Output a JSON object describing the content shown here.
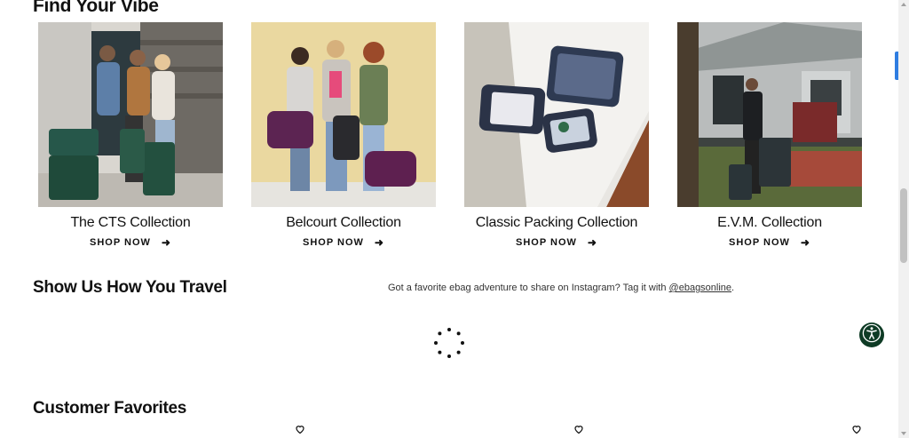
{
  "sections": {
    "vibe_title": "Find Your Vibe",
    "travel_title": "Show Us How You Travel",
    "travel_text": "Got a favorite ebag adventure to share on Instagram? Tag it with ",
    "travel_handle": "@ebagsonline",
    "travel_period": ".",
    "favorites_title": "Customer Favorites"
  },
  "collections": [
    {
      "name": "The CTS Collection",
      "cta": "SHOP NOW",
      "image_icon": "photo-group-with-green-luggage"
    },
    {
      "name": "Belcourt Collection",
      "cta": "SHOP NOW",
      "image_icon": "photo-three-women-with-purple-bags"
    },
    {
      "name": "Classic Packing Collection",
      "cta": "SHOP NOW",
      "image_icon": "photo-packing-cubes-on-bed"
    },
    {
      "name": "E.V.M. Collection",
      "cta": "SHOP NOW",
      "image_icon": "photo-man-with-dark-luggage"
    }
  ],
  "colors": {
    "accent_green": "#0e3b25",
    "scroll_tab": "#2f7de1"
  },
  "icons": {
    "arrow": "arrow-right-icon",
    "heart": "heart-icon",
    "accessibility": "accessibility-icon",
    "loading": "loading-spinner-icon"
  }
}
